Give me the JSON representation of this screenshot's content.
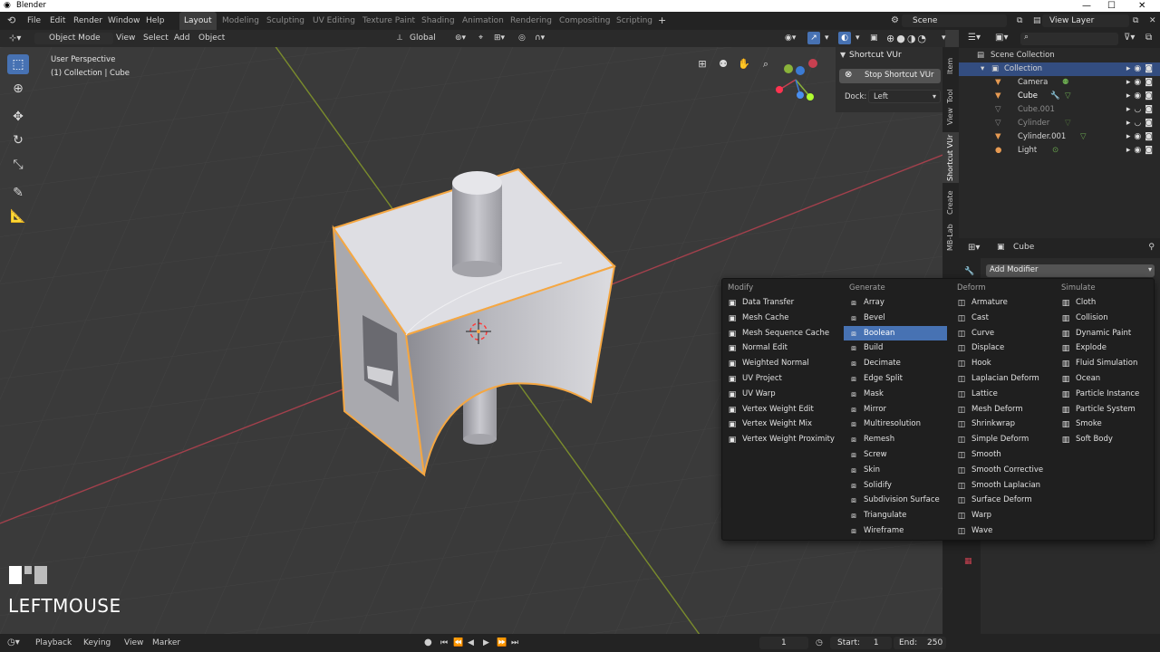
{
  "window": {
    "title": "Blender"
  },
  "menubar": {
    "items": [
      "File",
      "Edit",
      "Render",
      "Window",
      "Help"
    ]
  },
  "workspaces": [
    "Layout",
    "Modeling",
    "Sculpting",
    "UV Editing",
    "Texture Paint",
    "Shading",
    "Animation",
    "Rendering",
    "Compositing",
    "Scripting"
  ],
  "workspace_add": "+",
  "scene": {
    "name": "Scene",
    "view_layer": "View Layer"
  },
  "viewport_header": {
    "mode": "Object Mode",
    "menus": [
      "View",
      "Select",
      "Add",
      "Object"
    ],
    "orientation": "Global"
  },
  "viewport": {
    "perspective": "User Perspective",
    "object_info": "(1) Collection | Cube"
  },
  "npanel": {
    "title": "Shortcut VUr",
    "stop_button": "Stop Shortcut VUr",
    "dock_label": "Dock:",
    "dock_value": "Left"
  },
  "vertical_tabs": [
    "Item",
    "Tool",
    "View",
    "Shortcut VUr",
    "Create",
    "MB-Lab"
  ],
  "outliner": {
    "search_placeholder": "",
    "rows": [
      {
        "label": "Scene Collection",
        "icon": "scene-collection-icon"
      },
      {
        "label": "Collection",
        "icon": "collection-icon"
      },
      {
        "label": "Camera",
        "icon": "camera-icon"
      },
      {
        "label": "Cube",
        "icon": "mesh-icon"
      },
      {
        "label": "Cube.001",
        "icon": "mesh-icon"
      },
      {
        "label": "Cylinder",
        "icon": "mesh-icon"
      },
      {
        "label": "Cylinder.001",
        "icon": "mesh-icon"
      },
      {
        "label": "Light",
        "icon": "light-icon"
      }
    ]
  },
  "properties": {
    "object_name": "Cube",
    "add_modifier": "Add Modifier"
  },
  "modifier_menu": {
    "columns": [
      {
        "heading": "Modify",
        "items": [
          "Data Transfer",
          "Mesh Cache",
          "Mesh Sequence Cache",
          "Normal Edit",
          "Weighted Normal",
          "UV Project",
          "UV Warp",
          "Vertex Weight Edit",
          "Vertex Weight Mix",
          "Vertex Weight Proximity"
        ]
      },
      {
        "heading": "Generate",
        "items": [
          "Array",
          "Bevel",
          "Boolean",
          "Build",
          "Decimate",
          "Edge Split",
          "Mask",
          "Mirror",
          "Multiresolution",
          "Remesh",
          "Screw",
          "Skin",
          "Solidify",
          "Subdivision Surface",
          "Triangulate",
          "Wireframe"
        ]
      },
      {
        "heading": "Deform",
        "items": [
          "Armature",
          "Cast",
          "Curve",
          "Displace",
          "Hook",
          "Laplacian Deform",
          "Lattice",
          "Mesh Deform",
          "Shrinkwrap",
          "Simple Deform",
          "Smooth",
          "Smooth Corrective",
          "Smooth Laplacian",
          "Surface Deform",
          "Warp",
          "Wave"
        ]
      },
      {
        "heading": "Simulate",
        "items": [
          "Cloth",
          "Collision",
          "Dynamic Paint",
          "Explode",
          "Fluid Simulation",
          "Ocean",
          "Particle Instance",
          "Particle System",
          "Smoke",
          "Soft Body"
        ]
      }
    ],
    "highlighted": "Boolean"
  },
  "key_overlay": {
    "text": "LEFTMOUSE"
  },
  "timeline": {
    "menus": [
      "Playback",
      "Keying",
      "View",
      "Marker"
    ],
    "current_frame": "1",
    "start_label": "Start:",
    "start": "1",
    "end_label": "End:",
    "end": "250"
  },
  "colors": {
    "accent": "#4772b3",
    "selection_outline": "#f5a742",
    "cursor_ring": "#c8c61e",
    "x_axis": "#d14a5a",
    "y_axis": "#8ab33a"
  }
}
